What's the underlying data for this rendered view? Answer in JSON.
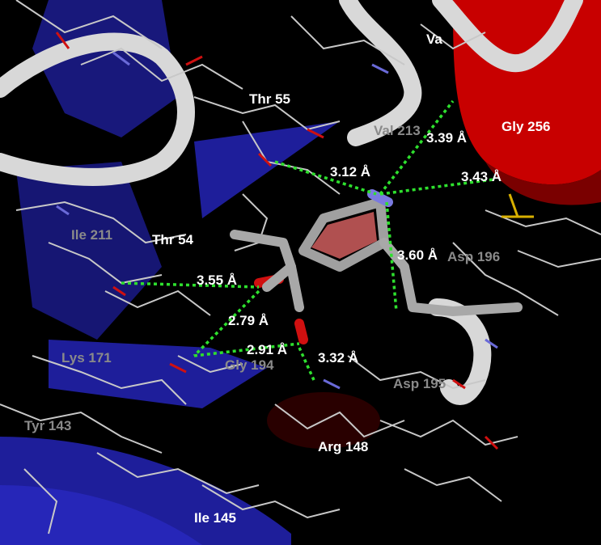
{
  "colors": {
    "background": "#000000",
    "sheet": "#1e1e9a",
    "helix": "#d40000",
    "ribbon": "#d8d8d8",
    "hbond": "#2ee02e",
    "carbon": "#c8c8c8",
    "oxygen": "#d01010",
    "nitrogen": "#6a6ad8",
    "sulfur": "#d8b000"
  },
  "residues": {
    "val": "Va",
    "thr55": "Thr 55",
    "val213": "Val 213",
    "gly256": "Gly 256",
    "ile211": "Ile 211",
    "thr54": "Thr 54",
    "asp196": "Asp 196",
    "lys171": "Lys 171",
    "gly194": "Gly 194",
    "asp195": "Asp 195",
    "tyr143": "Tyr 143",
    "arg148": "Arg 148",
    "ile145": "Ile 145"
  },
  "distances": {
    "d339": "3.39 Å",
    "d312": "3.12 Å",
    "d343": "3.43 Å",
    "d360": "3.60 Å",
    "d355": "3.55 Å",
    "d279": "2.79 Å",
    "d291": "2.91 Å",
    "d332": "3.32 Å"
  }
}
